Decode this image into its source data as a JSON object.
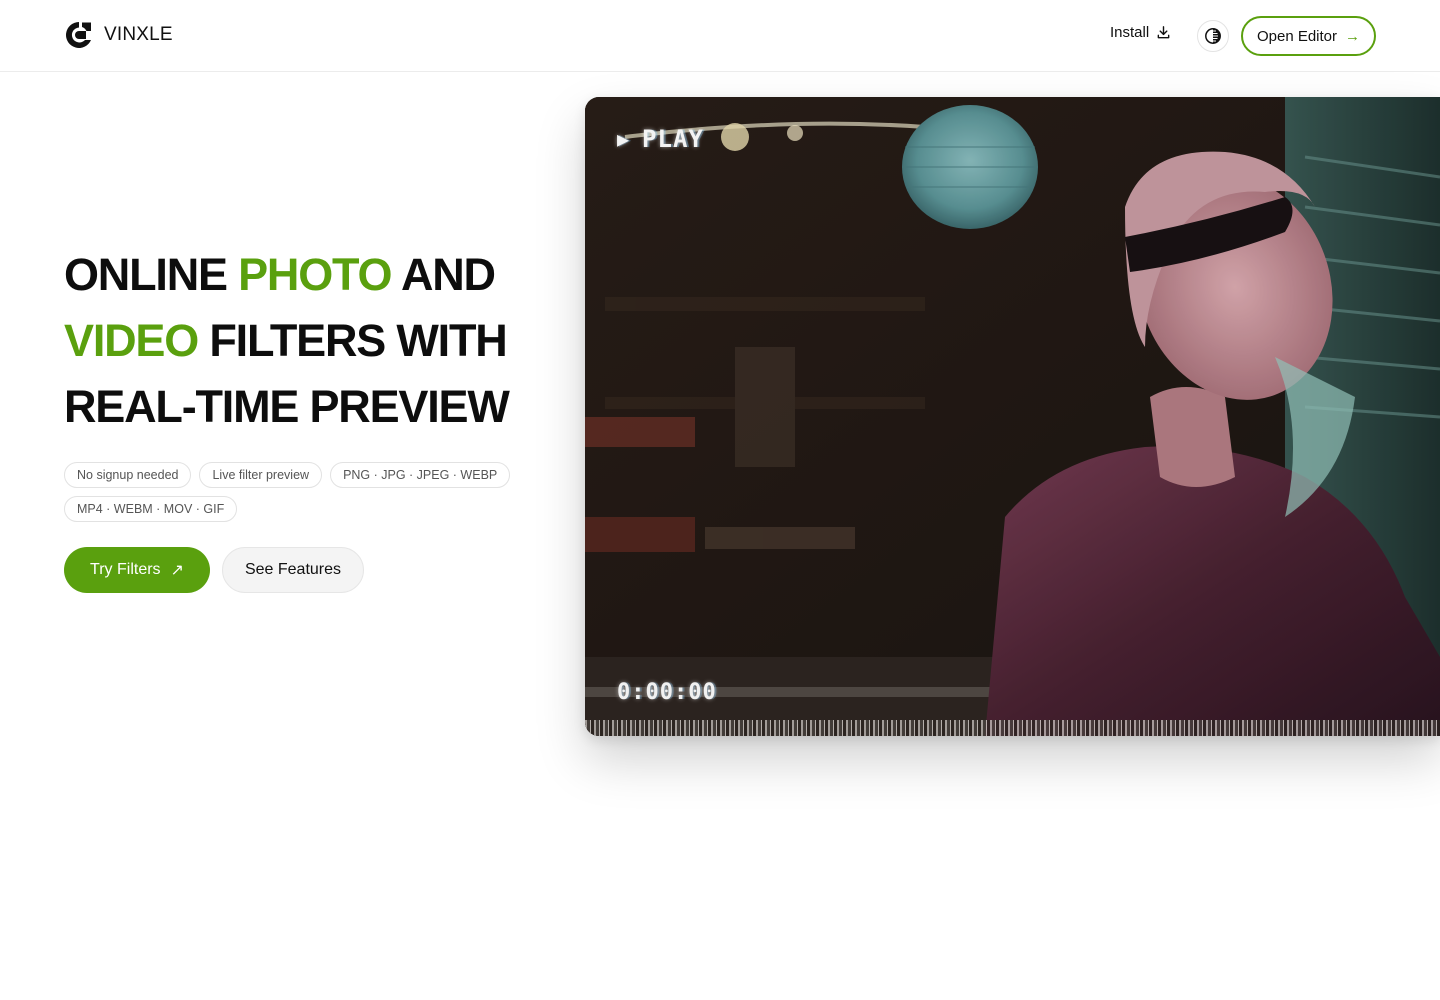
{
  "header": {
    "brand": "VINXLE",
    "logo_icon": "vinxle-logo-icon",
    "install_label": "Install",
    "install_icon": "download-icon",
    "theme_icon": "contrast-icon",
    "open_editor_label": "Open Editor",
    "open_editor_arrow": "→"
  },
  "hero": {
    "headline": {
      "line1_a": "ONLINE ",
      "line1_accent": "PHOTO",
      "line1_b": " AND",
      "line2_accent": "VIDEO",
      "line2_b": " FILTERS WITH",
      "line3": "REAL-TIME PREVIEW"
    },
    "tags": [
      "No signup needed",
      "Live filter preview",
      "PNG · JPG · JPEG · WEBP",
      "MP4 · WEBM · MOV · GIF"
    ],
    "primary_cta": "Try Filters",
    "primary_cta_arrow": "↗",
    "secondary_cta": "See Features"
  },
  "preview": {
    "osd_play_icon": "▶",
    "osd_play_label": "PLAY",
    "osd_timecode": "0:00:00"
  },
  "colors": {
    "accent": "#5aa00e",
    "text": "#0d0d0d",
    "border": "#e2e2e2"
  }
}
